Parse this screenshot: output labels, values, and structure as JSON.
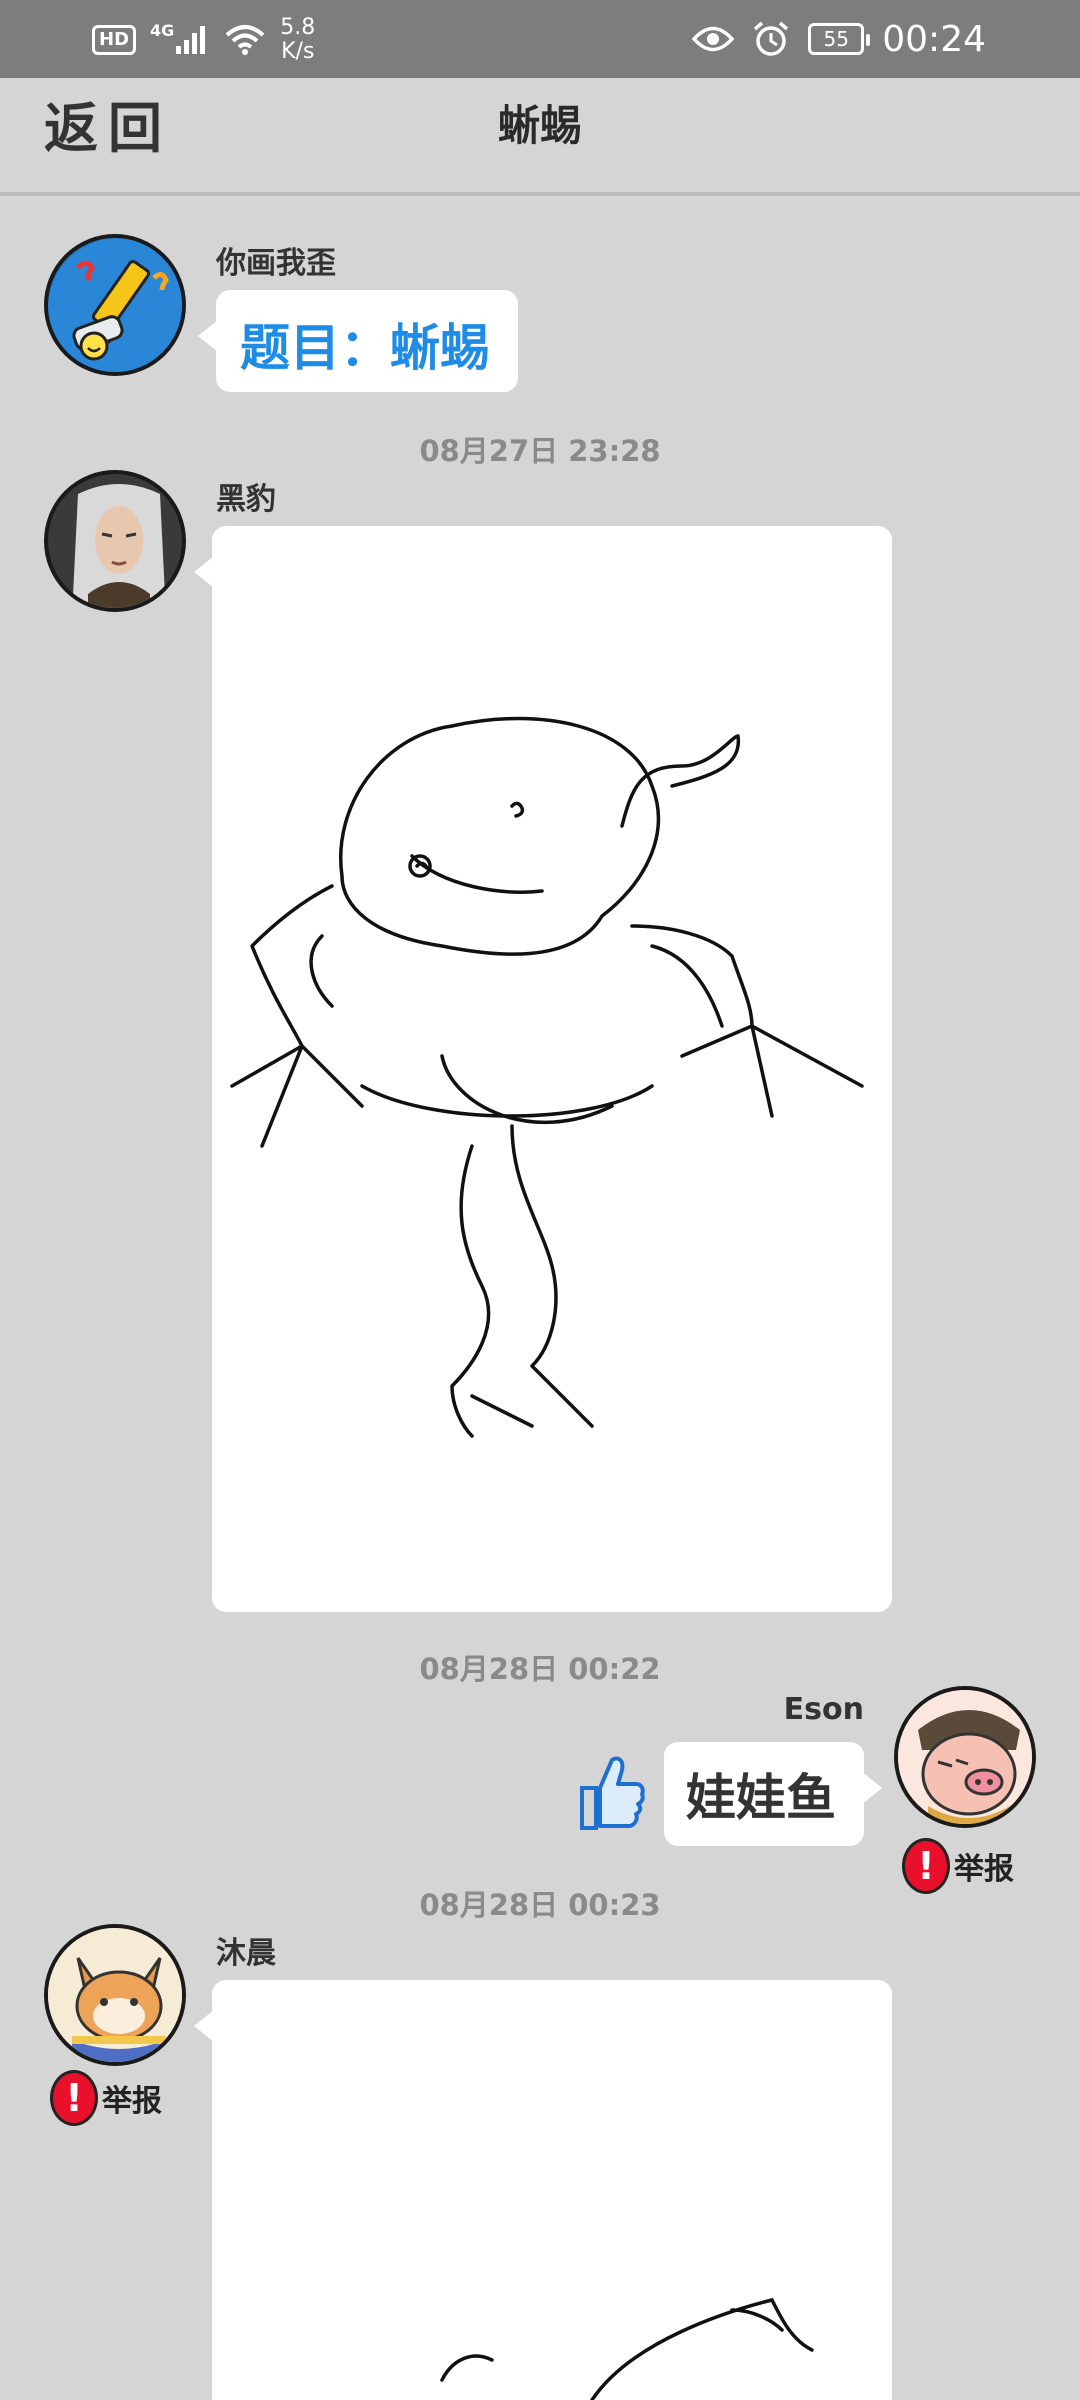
{
  "status_bar": {
    "hd": "HD",
    "network": "4G",
    "speed_value": "5.8",
    "speed_unit": "K/s",
    "battery": "55",
    "time": "00:24"
  },
  "header": {
    "back_label": "返回",
    "title": "蜥蜴"
  },
  "messages": {
    "topic": {
      "sender": "你画我歪",
      "text": "题目：蜥蜴"
    },
    "time1": "08月27日  23:28",
    "drawing1": {
      "sender": "黑豹"
    },
    "time2": "08月28日  00:22",
    "answer": {
      "sender": "Eson",
      "text": "娃娃鱼",
      "report_label": "举报"
    },
    "time3": "08月28日  00:23",
    "drawing2": {
      "sender": "沐晨",
      "report_label": "举报"
    }
  },
  "icons": {
    "back": "back-arrow-text",
    "like": "thumbs-up-icon",
    "report": "exclamation-icon",
    "eye": "eye-icon",
    "alarm": "alarm-icon",
    "wifi": "wifi-icon",
    "signal": "signal-icon"
  },
  "colors": {
    "topic_blue": "#1e8ce6",
    "report_red": "#e8102a",
    "background": "#d5d5d5"
  }
}
